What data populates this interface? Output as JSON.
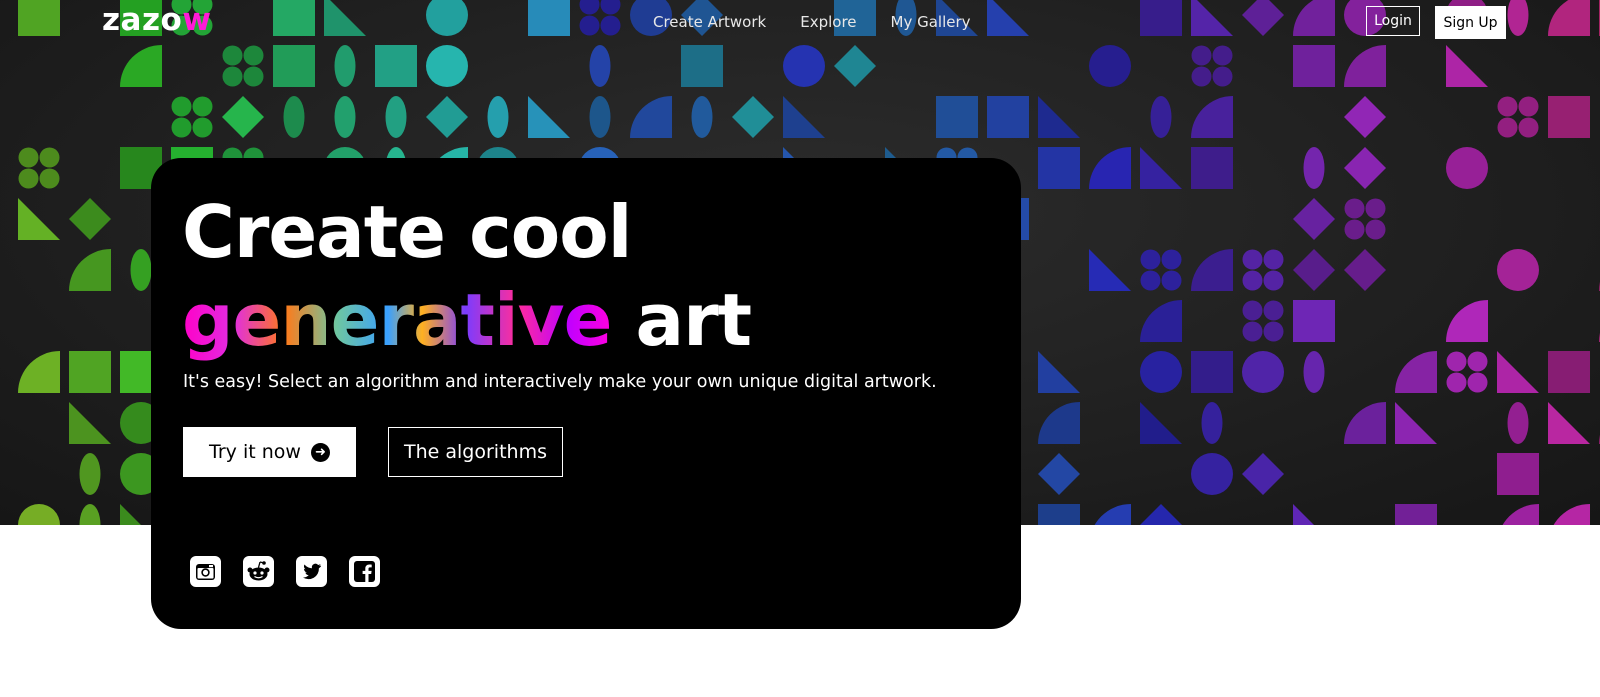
{
  "nav": {
    "logo": "zazo",
    "logo_accent": "w",
    "links": [
      "Create Artwork",
      "Explore",
      "My Gallery"
    ],
    "login": "Login",
    "signup": "Sign Up"
  },
  "hero": {
    "headline_line1": "Create cool",
    "headline_gradient": "generative",
    "headline_rest": " art",
    "subtitle": "It's easy! Select an algorithm and interactively make your own unique digital artwork.",
    "try_button": "Try it now",
    "try_button_icon": "arrow-circle-right-icon",
    "algorithms_button": "The algorithms"
  },
  "socials": [
    "instagram-icon",
    "reddit-icon",
    "twitter-icon",
    "facebook-icon"
  ],
  "colors": {
    "logo_accent": "#ff1ad6",
    "card": "#000000",
    "hero_background": "#1f1f1f"
  }
}
